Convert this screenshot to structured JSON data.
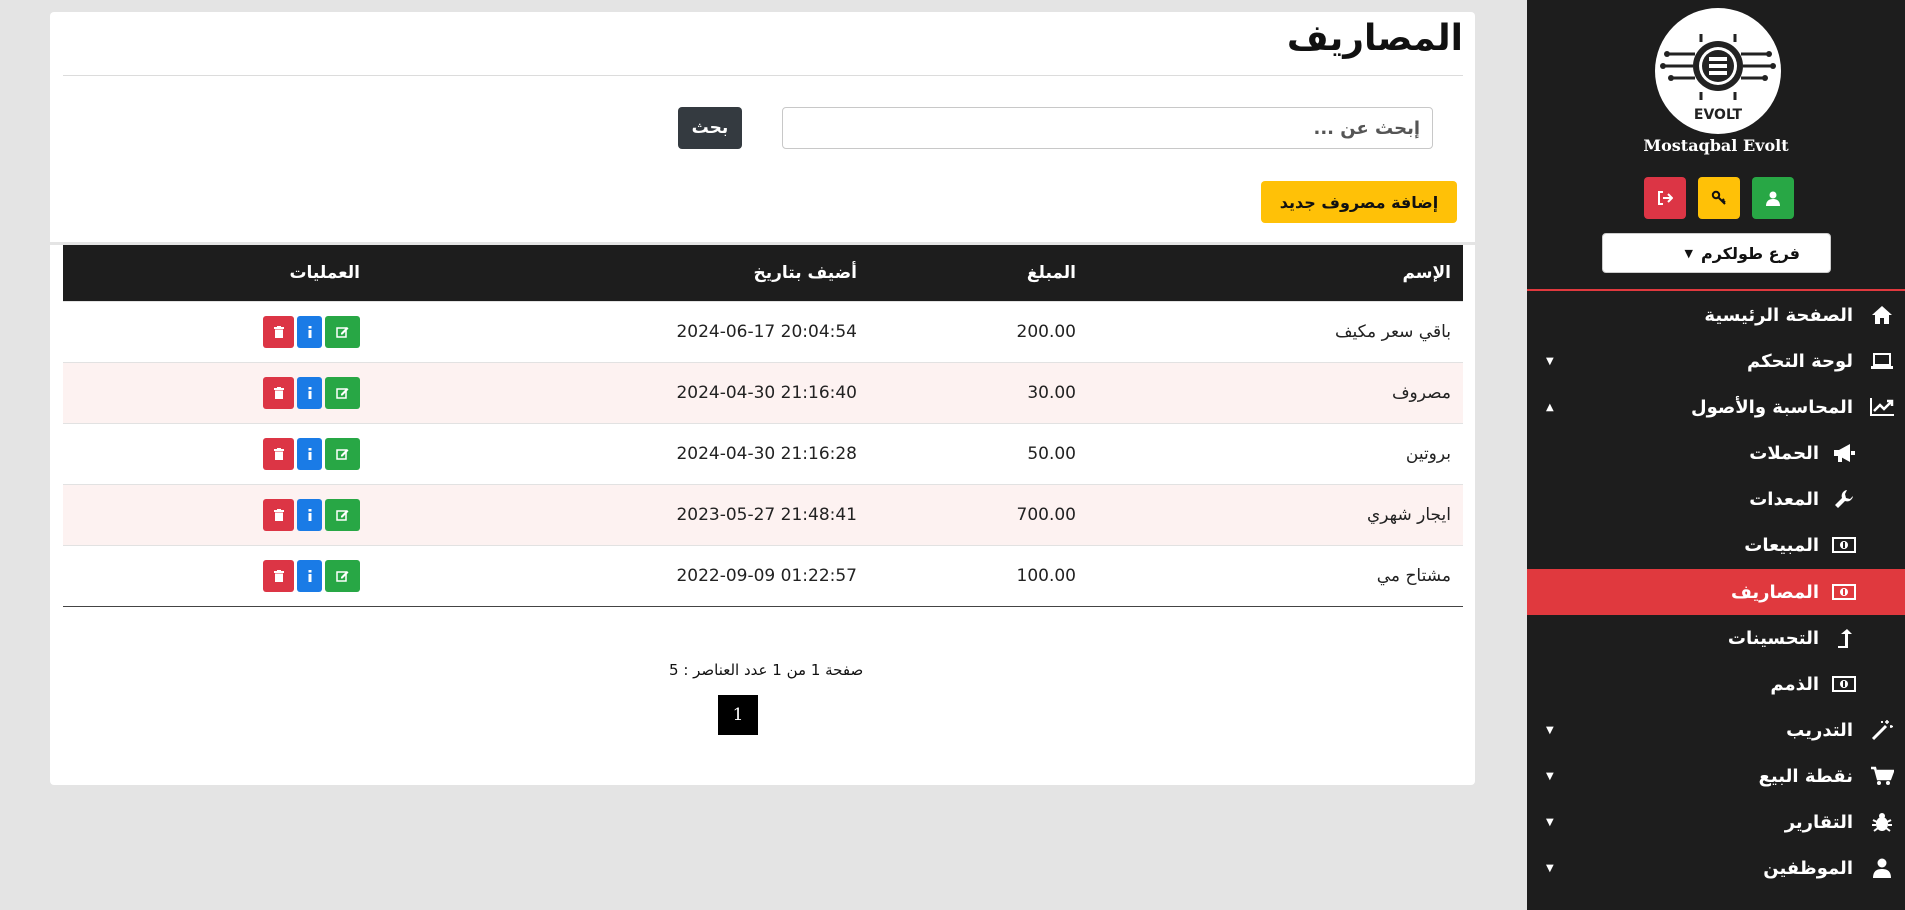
{
  "sidebar": {
    "logo_text": "EVOLT",
    "brand": "Mostaqbal Evolt",
    "branch_select": "فرع طولكرم",
    "items": [
      {
        "label": "الصفحة الرئيسية",
        "icon": "home-icon"
      },
      {
        "label": "لوحة التحكم",
        "icon": "laptop-icon",
        "caret": "▼"
      },
      {
        "label": "المحاسبة والأصول",
        "icon": "chart-line-icon",
        "caret": "▲"
      },
      {
        "label": "الحملات",
        "icon": "bullhorn-icon"
      },
      {
        "label": "المعدات",
        "icon": "wrench-icon"
      },
      {
        "label": "المبيعات",
        "icon": "money-bill-icon"
      },
      {
        "label": "المصاريف",
        "icon": "money-bill-icon"
      },
      {
        "label": "التحسينات",
        "icon": "level-up-icon"
      },
      {
        "label": "الذمم",
        "icon": "money-bill-icon"
      },
      {
        "label": "التدريب",
        "icon": "magic-wand-icon",
        "caret": "▼"
      },
      {
        "label": "نقطة البيع",
        "icon": "cart-icon",
        "caret": "▼"
      },
      {
        "label": "التقارير",
        "icon": "bug-icon",
        "caret": "▼"
      },
      {
        "label": "الموظفين",
        "icon": "user-icon",
        "caret": "▼"
      }
    ]
  },
  "page": {
    "title": "المصاريف",
    "search_placeholder": "إبحث عن ...",
    "search_button": "بحث",
    "add_button": "إضافة مصروف جديد"
  },
  "table": {
    "headers": {
      "name": "الإسم",
      "amount": "المبلغ",
      "date": "أضيف بتاريخ",
      "ops": "العمليات"
    },
    "rows": [
      {
        "name": "باقي سعر مكيف",
        "amount": "200.00",
        "date": "2024-06-17 20:04:54"
      },
      {
        "name": "مصروف",
        "amount": "30.00",
        "date": "2024-04-30 21:16:40"
      },
      {
        "name": "بروتين",
        "amount": "50.00",
        "date": "2024-04-30 21:16:28"
      },
      {
        "name": "ايجار شهري",
        "amount": "700.00",
        "date": "2023-05-27 21:48:41"
      },
      {
        "name": "مشتاح مي",
        "amount": "100.00",
        "date": "2022-09-09 01:22:57"
      }
    ]
  },
  "pagination": {
    "info": "صفحة 1 من 1 عدد العناصر : 5",
    "current": "1"
  },
  "colors": {
    "sidebar_bg": "#1d1d1d",
    "accent_red": "#e0393e",
    "add_button": "#ffc107",
    "header_row": "#1d1d1d"
  }
}
